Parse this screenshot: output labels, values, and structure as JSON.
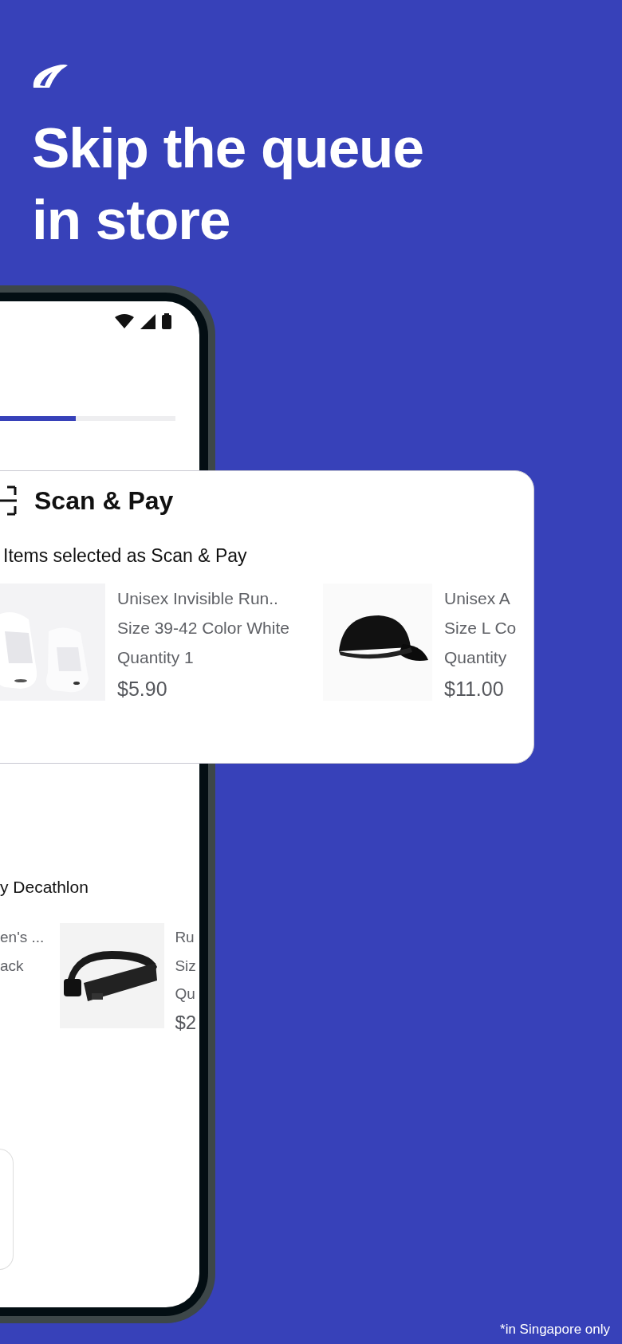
{
  "headline": "Skip the queue in store",
  "phone": {
    "progress": {
      "level": 0.52
    },
    "section_title": "y Decathlon",
    "products": [
      {
        "name": "en's ...",
        "variant": "ack"
      },
      {
        "kind": "picture",
        "name": "Ru",
        "variant": "Siz",
        "quantity": "Qu",
        "price": "$2"
      }
    ]
  },
  "card": {
    "title": "Scan & Pay",
    "subtitle": "Items selected as Scan & Pay",
    "products": [
      {
        "kind": "picture",
        "name": "Unisex Invisible Run..",
        "variant": "Size 39-42 Color White",
        "quantity": "Quantity 1",
        "price": "$5.90"
      },
      {
        "kind": "picture",
        "name": "Unisex A",
        "variant": "Size L Co",
        "quantity": "Quantity",
        "price": "$11.00"
      }
    ]
  },
  "footnote": "*in Singapore only"
}
